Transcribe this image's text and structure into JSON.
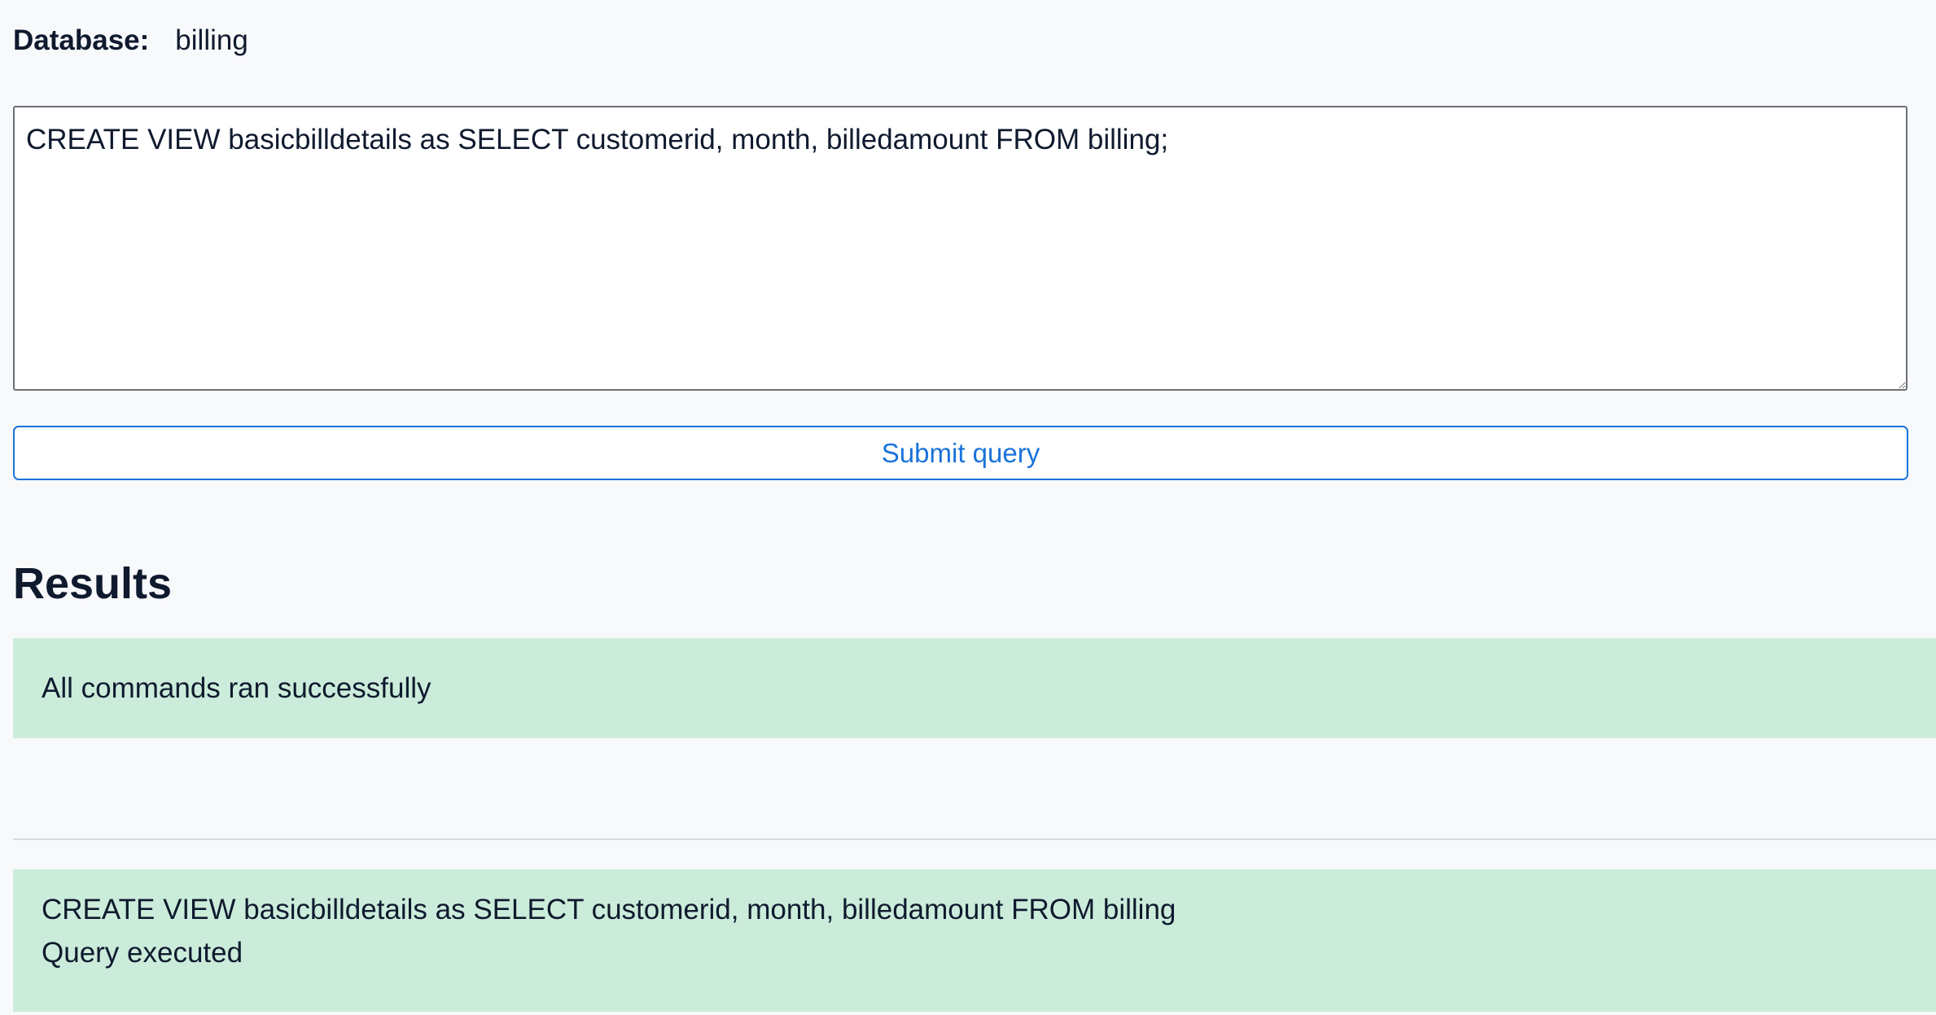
{
  "database": {
    "label": "Database:",
    "value": "billing"
  },
  "query": {
    "text": "CREATE VIEW basicbilldetails as SELECT customerid, month, billedamount FROM billing;"
  },
  "submit": {
    "label": "Submit query",
    "color": "#1a73d9"
  },
  "results": {
    "heading": "Results",
    "summary": "All commands ran successfully",
    "items": [
      {
        "statement": "CREATE VIEW basicbilldetails as SELECT customerid, month, billedamount FROM billing",
        "status": "Query executed"
      }
    ],
    "success_color": "#cbecda"
  }
}
